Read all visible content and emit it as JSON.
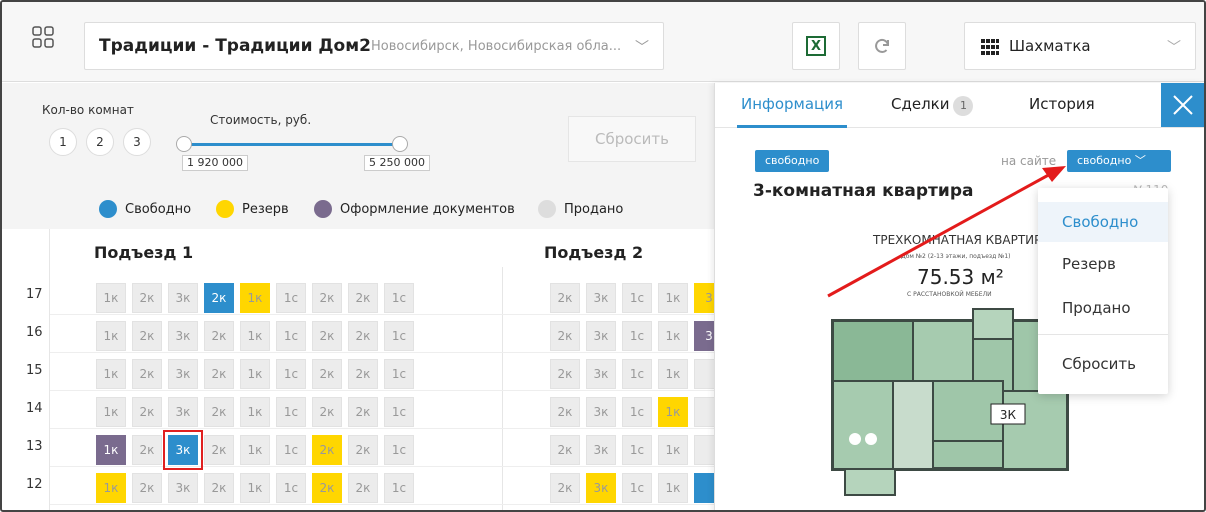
{
  "topbar": {
    "project_title": "Традиции - Традиции Дом2",
    "project_location": "Новосибирск, Новосибирская обла...",
    "view_label": "Шахматка"
  },
  "filters": {
    "rooms_label": "Кол-во комнат",
    "rooms": [
      "1",
      "2",
      "3"
    ],
    "price_label": "Стоимость, руб.",
    "price_min": "1 920 000",
    "price_max": "5 250 000",
    "reset_label": "Сбросить"
  },
  "legend": [
    {
      "label": "Свободно",
      "color": "#2d8ecc"
    },
    {
      "label": "Резерв",
      "color": "#ffd600"
    },
    {
      "label": "Оформление документов",
      "color": "#7a6b8e"
    },
    {
      "label": "Продано",
      "color": "#dddddd"
    }
  ],
  "entrances": [
    {
      "title": "Подъезд 1"
    },
    {
      "title": "Подъезд 2"
    }
  ],
  "floors": [
    "17",
    "16",
    "15",
    "14",
    "13",
    "12"
  ],
  "grid": {
    "entrance1": [
      [
        [
          "1к",
          ""
        ],
        [
          "2к",
          ""
        ],
        [
          "3к",
          ""
        ],
        [
          "2к",
          "free"
        ],
        [
          "1к",
          "reserve"
        ],
        [
          "1с",
          ""
        ],
        [
          "2к",
          ""
        ],
        [
          "2к",
          ""
        ],
        [
          "1с",
          ""
        ]
      ],
      [
        [
          "1к",
          ""
        ],
        [
          "2к",
          ""
        ],
        [
          "3к",
          ""
        ],
        [
          "2к",
          ""
        ],
        [
          "1к",
          ""
        ],
        [
          "1с",
          ""
        ],
        [
          "2к",
          ""
        ],
        [
          "2к",
          ""
        ],
        [
          "1с",
          ""
        ]
      ],
      [
        [
          "1к",
          ""
        ],
        [
          "2к",
          ""
        ],
        [
          "3к",
          ""
        ],
        [
          "2к",
          ""
        ],
        [
          "1к",
          ""
        ],
        [
          "1с",
          ""
        ],
        [
          "2к",
          ""
        ],
        [
          "2к",
          ""
        ],
        [
          "1с",
          ""
        ]
      ],
      [
        [
          "1к",
          ""
        ],
        [
          "2к",
          ""
        ],
        [
          "3к",
          ""
        ],
        [
          "2к",
          ""
        ],
        [
          "1к",
          ""
        ],
        [
          "1с",
          ""
        ],
        [
          "2к",
          ""
        ],
        [
          "2к",
          ""
        ],
        [
          "1с",
          ""
        ]
      ],
      [
        [
          "1к",
          "docs"
        ],
        [
          "2к",
          ""
        ],
        [
          "3к",
          "free sel"
        ],
        [
          "2к",
          ""
        ],
        [
          "1к",
          ""
        ],
        [
          "1с",
          ""
        ],
        [
          "2к",
          "reserve"
        ],
        [
          "2к",
          ""
        ],
        [
          "1с",
          ""
        ]
      ],
      [
        [
          "1к",
          "reserve"
        ],
        [
          "2к",
          ""
        ],
        [
          "3к",
          ""
        ],
        [
          "2к",
          ""
        ],
        [
          "1к",
          ""
        ],
        [
          "1с",
          ""
        ],
        [
          "2к",
          "reserve"
        ],
        [
          "2к",
          ""
        ],
        [
          "1с",
          ""
        ]
      ]
    ],
    "entrance2": [
      [
        [
          "2к",
          ""
        ],
        [
          "3к",
          ""
        ],
        [
          "1с",
          ""
        ],
        [
          "1к",
          ""
        ],
        [
          "3",
          "reserve"
        ]
      ],
      [
        [
          "2к",
          ""
        ],
        [
          "3к",
          ""
        ],
        [
          "1с",
          ""
        ],
        [
          "1к",
          ""
        ],
        [
          "3",
          "docs"
        ]
      ],
      [
        [
          "2к",
          ""
        ],
        [
          "3к",
          ""
        ],
        [
          "1с",
          ""
        ],
        [
          "1к",
          ""
        ],
        [
          "",
          ""
        ]
      ],
      [
        [
          "2к",
          ""
        ],
        [
          "3к",
          ""
        ],
        [
          "1с",
          ""
        ],
        [
          "1к",
          "reserve"
        ],
        [
          "",
          ""
        ]
      ],
      [
        [
          "2к",
          ""
        ],
        [
          "3к",
          ""
        ],
        [
          "1с",
          ""
        ],
        [
          "1к",
          ""
        ],
        [
          "",
          ""
        ]
      ],
      [
        [
          "2к",
          ""
        ],
        [
          "3к",
          "reserve"
        ],
        [
          "1с",
          ""
        ],
        [
          "1к",
          ""
        ],
        [
          "",
          "free"
        ]
      ]
    ]
  },
  "panel": {
    "tabs": {
      "info": "Информация",
      "deals": "Сделки",
      "deals_count": "1",
      "history": "История"
    },
    "status_badge": "свободно",
    "onsite_label": "на сайте",
    "onsite_value": "свободно",
    "apartment_title": "3-комнатная квартира",
    "apartment_number": "№110",
    "plan_title": "ТРЕХКОМНАТНАЯ КВАРТИРА",
    "plan_subtitle": "Дом №2 (2-13 этажи, подъезд №1)",
    "plan_area": "75.53 м²",
    "plan_note": "С РАССТАНОВКОЙ МЕБЕЛИ",
    "plan_badge": "3К"
  },
  "status_menu": [
    "Свободно",
    "Резерв",
    "Продано",
    "Сбросить"
  ]
}
